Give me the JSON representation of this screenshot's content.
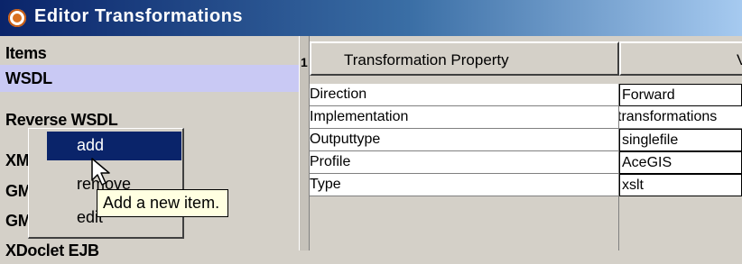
{
  "window": {
    "title": "Editor Transformations",
    "icon": "app-gear-icon"
  },
  "items_panel": {
    "header": "Items",
    "items": [
      {
        "label": "WSDL",
        "selected": true
      },
      {
        "label": "Reverse WSDL",
        "selected": false
      },
      {
        "label": "XM",
        "selected": false
      },
      {
        "label": "GM",
        "selected": false
      },
      {
        "label": "GM",
        "selected": false
      },
      {
        "label": "XDoclet EJB",
        "selected": false
      }
    ]
  },
  "splitter": {
    "grip": "1"
  },
  "table": {
    "columns": [
      "Transformation Property",
      "V"
    ],
    "rows": [
      {
        "property": "Direction",
        "value": "Forward"
      },
      {
        "property": "Implementation",
        "value": "transformations"
      },
      {
        "property": "Outputtype",
        "value": "singlefile"
      },
      {
        "property": "Profile",
        "value": "AceGIS"
      },
      {
        "property": "Type",
        "value": "xslt"
      }
    ]
  },
  "context_menu": {
    "items": [
      {
        "label": "add",
        "active": true
      },
      {
        "label": "remove",
        "active": false
      },
      {
        "label": "edit",
        "active": false
      }
    ]
  },
  "tooltip": {
    "text": "Add a new item."
  },
  "colors": {
    "titlebar_start": "#0a246a",
    "titlebar_end": "#a6caf0",
    "selection": "#c9c9f4",
    "menu_highlight": "#0a246a",
    "tooltip_bg": "#ffffe1"
  }
}
